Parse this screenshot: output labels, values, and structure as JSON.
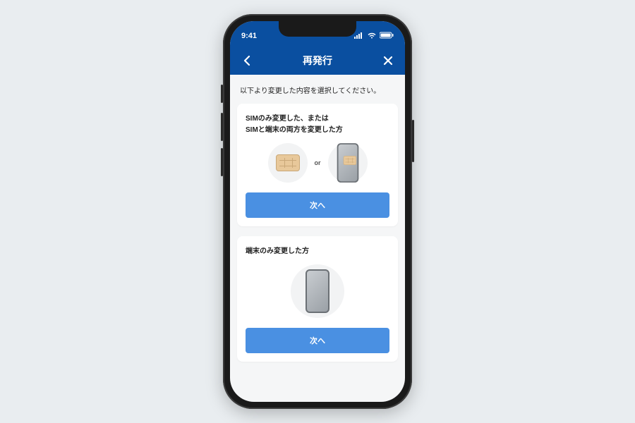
{
  "status": {
    "time": "9:41"
  },
  "nav": {
    "title": "再発行"
  },
  "prompt": "以下より変更した内容を選択してください。",
  "cards": [
    {
      "title_line1": "SIMのみ変更した、または",
      "title_line2": "SIMと端末の両方を変更した方",
      "or_label": "or",
      "button": "次へ"
    },
    {
      "title": "端末のみ変更した方",
      "button": "次へ"
    }
  ]
}
